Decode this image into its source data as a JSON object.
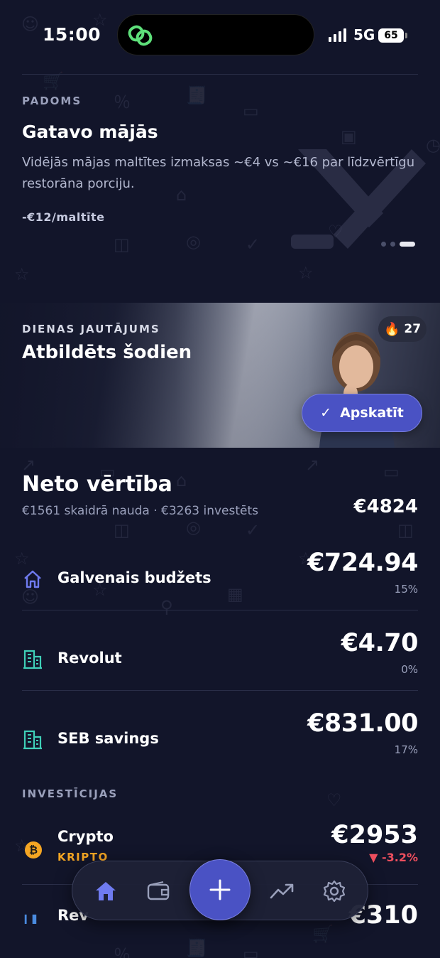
{
  "status_bar": {
    "time": "15:00",
    "network": "5G",
    "battery": "65"
  },
  "tip": {
    "label": "PADOMS",
    "title": "Gatavo mājās",
    "text": "Vidējās mājas maltītes izmaksas ~€4 vs ~€16 par līdzvērtīgu restorāna porciju.",
    "saving": "-€12/maltīte",
    "page_count": 3,
    "active_page": 3
  },
  "daily_question": {
    "label": "DIENAS JAUTĀJUMS",
    "title": "Atbildēts šodien",
    "streak": "27",
    "view_button": "Apskatīt"
  },
  "net_worth": {
    "title": "Neto vērtība",
    "subtitle": "€1561 skaidrā nauda · €3263 investēts",
    "total": "€4824"
  },
  "accounts": [
    {
      "name": "Galvenais budžets",
      "amount": "€724.94",
      "percent": "15%",
      "icon": "home-icon"
    },
    {
      "name": "Revolut",
      "amount": "€4.70",
      "percent": "0%",
      "icon": "bank-building-icon"
    },
    {
      "name": "SEB savings",
      "amount": "€831.00",
      "percent": "17%",
      "icon": "bank-building-icon"
    }
  ],
  "investments": {
    "label": "INVESTĪCIJAS",
    "items": [
      {
        "name": "Crypto",
        "tag": "KRIPTO",
        "amount": "€2953",
        "change": "▼ -3.2%",
        "icon": "bitcoin-icon"
      },
      {
        "name": "Rev",
        "amount": "€310",
        "icon": "chart-icon"
      }
    ]
  },
  "tab_bar": {
    "items": [
      "home-icon",
      "wallet-icon",
      "add-icon",
      "trending-icon",
      "settings-icon"
    ],
    "active": "home-icon"
  },
  "colors": {
    "background": "#12152a",
    "accent": "#4a52c4",
    "crypto": "#f5a623",
    "negative": "#ef4f5e"
  }
}
